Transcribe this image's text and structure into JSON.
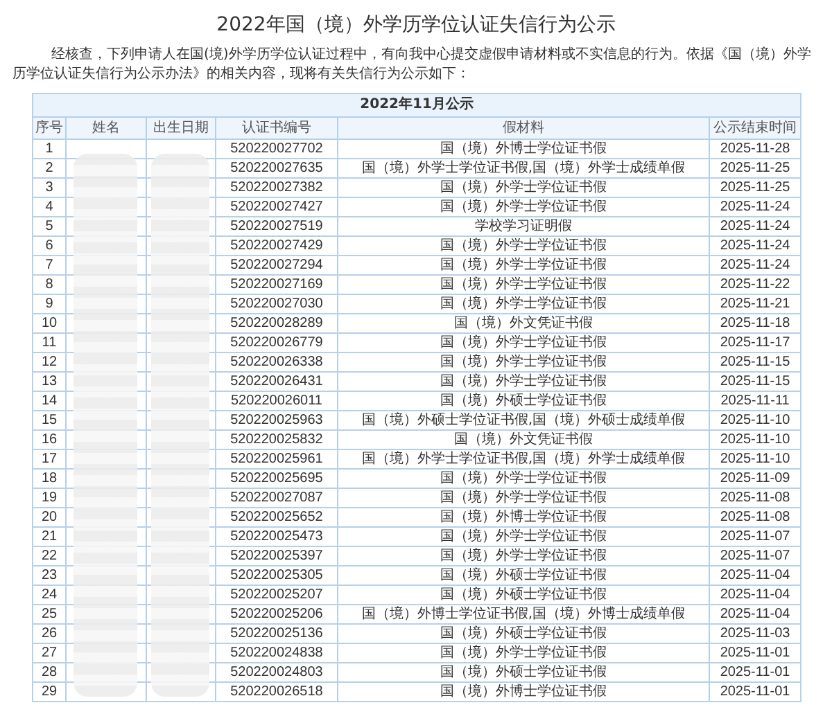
{
  "page_title": "2022年国（境）外学历学位认证失信行为公示",
  "intro": "经核查，下列申请人在国(境)外学历学位认证过程中，有向我中心提交虚假申请材料或不实信息的行为。依据《国（境）外学历学位认证失信行为公示办法》的相关内容，现将有关失信行为公示如下：",
  "table": {
    "caption": "2022年11月公示",
    "columns": [
      "序号",
      "姓名",
      "出生日期",
      "认证书编号",
      "假材料",
      "公示结束时间"
    ],
    "rows": [
      [
        "1",
        "",
        "",
        "520220027702",
        "国（境）外博士学位证书假",
        "2025-11-28"
      ],
      [
        "2",
        "",
        "",
        "520220027635",
        "国（境）外学士学位证书假,国（境）外学士成绩单假",
        "2025-11-25"
      ],
      [
        "3",
        "",
        "",
        "520220027382",
        "国（境）外学士学位证书假",
        "2025-11-25"
      ],
      [
        "4",
        "",
        "",
        "520220027427",
        "国（境）外学士学位证书假",
        "2025-11-24"
      ],
      [
        "5",
        "",
        "",
        "520220027519",
        "学校学习证明假",
        "2025-11-24"
      ],
      [
        "6",
        "",
        "",
        "520220027429",
        "国（境）外学士学位证书假",
        "2025-11-24"
      ],
      [
        "7",
        "",
        "",
        "520220027294",
        "国（境）外学士学位证书假",
        "2025-11-24"
      ],
      [
        "8",
        "",
        "",
        "520220027169",
        "国（境）外学士学位证书假",
        "2025-11-22"
      ],
      [
        "9",
        "",
        "",
        "520220027030",
        "国（境）外学士学位证书假",
        "2025-11-21"
      ],
      [
        "10",
        "",
        "",
        "520220028289",
        "国（境）外文凭证书假",
        "2025-11-18"
      ],
      [
        "11",
        "",
        "",
        "520220026779",
        "国（境）外学士学位证书假",
        "2025-11-17"
      ],
      [
        "12",
        "",
        "",
        "520220026338",
        "国（境）外学士学位证书假",
        "2025-11-15"
      ],
      [
        "13",
        "",
        "",
        "520220026431",
        "国（境）外学士学位证书假",
        "2025-11-15"
      ],
      [
        "14",
        "",
        "",
        "520220026011",
        "国（境）外硕士学位证书假",
        "2025-11-11"
      ],
      [
        "15",
        "",
        "",
        "520220025963",
        "国（境）外硕士学位证书假,国（境）外硕士成绩单假",
        "2025-11-10"
      ],
      [
        "16",
        "",
        "",
        "520220025832",
        "国（境）外文凭证书假",
        "2025-11-10"
      ],
      [
        "17",
        "",
        "",
        "520220025961",
        "国（境）外学士学位证书假,国（境）外学士成绩单假",
        "2025-11-10"
      ],
      [
        "18",
        "",
        "",
        "520220025695",
        "国（境）外学士学位证书假",
        "2025-11-09"
      ],
      [
        "19",
        "",
        "",
        "520220027087",
        "国（境）外学士学位证书假",
        "2025-11-08"
      ],
      [
        "20",
        "",
        "",
        "520220025652",
        "国（境）外博士学位证书假",
        "2025-11-08"
      ],
      [
        "21",
        "",
        "",
        "520220025473",
        "国（境）外学士学位证书假",
        "2025-11-07"
      ],
      [
        "22",
        "",
        "",
        "520220025397",
        "国（境）外学士学位证书假",
        "2025-11-07"
      ],
      [
        "23",
        "",
        "",
        "520220025305",
        "国（境）外硕士学位证书假",
        "2025-11-04"
      ],
      [
        "24",
        "",
        "",
        "520220025207",
        "国（境）外硕士学位证书假",
        "2025-11-04"
      ],
      [
        "25",
        "",
        "",
        "520220025206",
        "国（境）外博士学位证书假,国（境）外博士成绩单假",
        "2025-11-04"
      ],
      [
        "26",
        "",
        "",
        "520220025136",
        "国（境）外硕士学位证书假",
        "2025-11-03"
      ],
      [
        "27",
        "",
        "",
        "520220024838",
        "国（境）外学士学位证书假",
        "2025-11-01"
      ],
      [
        "28",
        "",
        "",
        "520220024803",
        "国（境）外硕士学位证书假",
        "2025-11-01"
      ],
      [
        "29",
        "",
        "",
        "520220026518",
        "国（境）外博士学位证书假",
        "2025-11-01"
      ]
    ]
  }
}
